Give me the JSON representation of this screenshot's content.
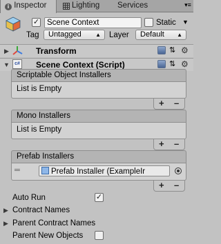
{
  "tabs": {
    "inspector": "Inspector",
    "lighting": "Lighting",
    "services": "Services"
  },
  "object": {
    "active": true,
    "name": "Scene Context",
    "static_label": "Static",
    "static_checked": false,
    "tag_label": "Tag",
    "tag_value": "Untagged",
    "layer_label": "Layer",
    "layer_value": "Default"
  },
  "components": {
    "transform": {
      "title": "Transform"
    },
    "scene_context": {
      "title": "Scene Context (Script)",
      "script_icon_text": "c#"
    }
  },
  "lists": {
    "scriptable": {
      "title": "Scriptable Object Installers",
      "empty_text": "List is Empty"
    },
    "mono": {
      "title": "Mono Installers",
      "empty_text": "List is Empty"
    },
    "prefab": {
      "title": "Prefab Installers",
      "items": [
        {
          "value": "Prefab Installer (ExampleIr"
        }
      ]
    }
  },
  "footer_buttons": {
    "add": "+",
    "remove": "–"
  },
  "properties": {
    "auto_run": {
      "label": "Auto Run",
      "checked": true
    },
    "contract_names": {
      "label": "Contract Names"
    },
    "parent_contract_names": {
      "label": "Parent Contract Names"
    },
    "parent_new_objects": {
      "label": "Parent New Objects",
      "checked": false
    }
  },
  "colors": {
    "panel_bg": "#c2c2c2",
    "tab_bar_bg": "#a5a5a5",
    "list_header_bg": "#b4b4b4",
    "transform_icon_red": "#e0463c",
    "transform_icon_blue": "#3c7be0"
  }
}
